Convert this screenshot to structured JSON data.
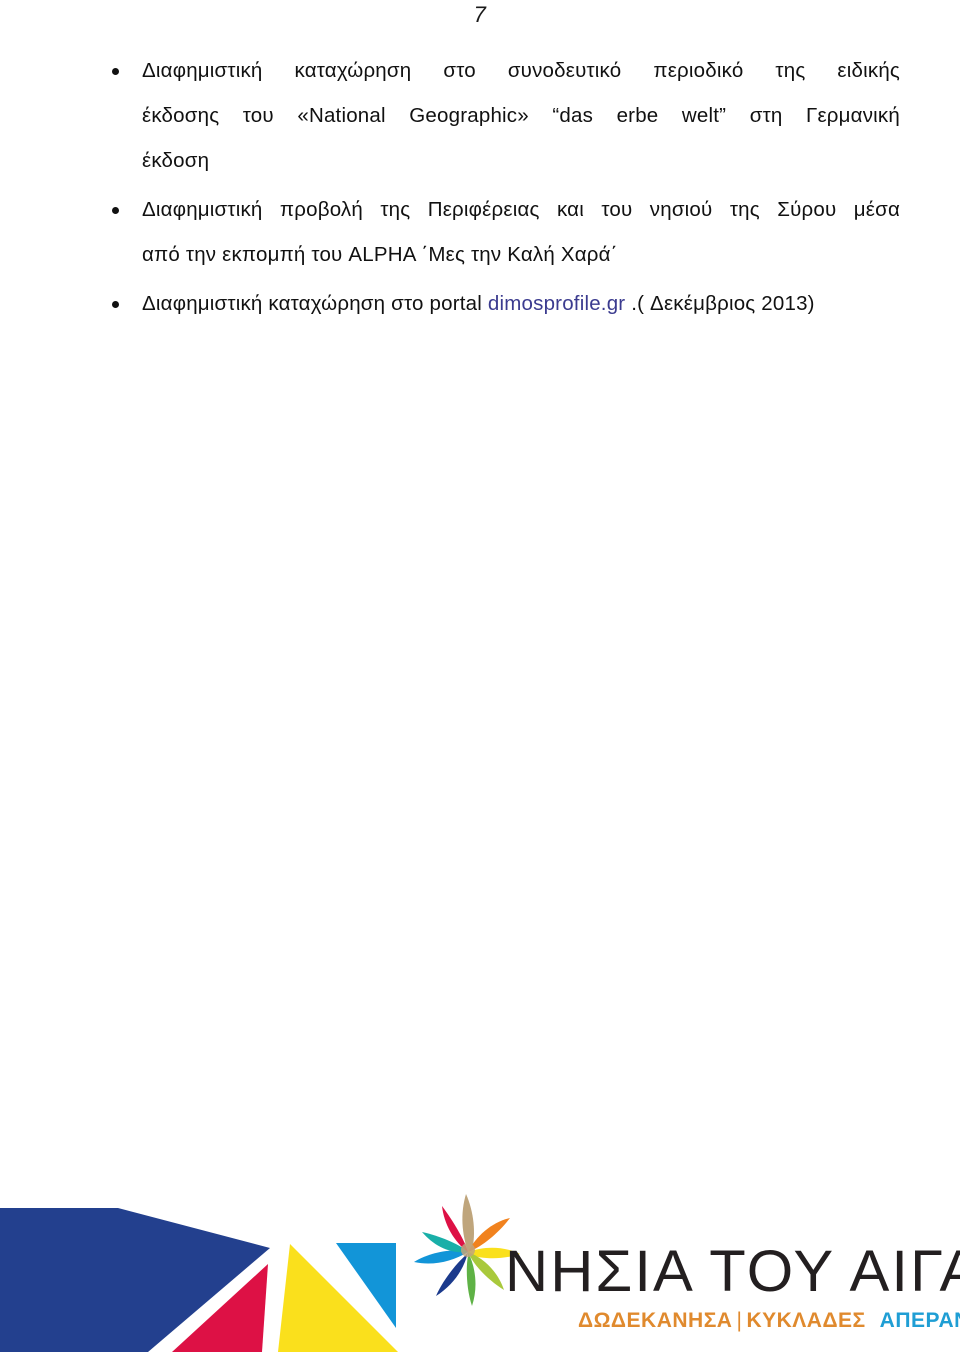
{
  "page": {
    "number": "7"
  },
  "content": {
    "bullets": [
      {
        "id": "bullet-national-geographic",
        "lines": [
          "Διαφημιστική καταχώρηση στο συνοδευτικό περιοδικό της ειδικής",
          "έκδοσης του «National Geographic» “das erbe welt” στη Γερμανική",
          "έκδοση"
        ]
      },
      {
        "id": "bullet-alpha-broadcast",
        "lines": [
          "Διαφημιστική προβολή της Περιφέρειας και του νησιού της Σύρου μέσα",
          "από την εκπομπή του ALPHA ΄Μες την Καλή Χαρά΄"
        ]
      },
      {
        "id": "bullet-dimosprofile-portal",
        "lines": [
          "Διαφημιστική καταχώρηση στο portal "
        ],
        "link_text": "dimosprofile.gr",
        "line_tail": " .( Δεκέμβριος 2013)"
      }
    ]
  },
  "footer": {
    "logo": {
      "wordmark": "ΝΗΣΙΑ ΤΟΥ ΑΙΓΑΙΟΥ",
      "subtitle_left": "ΔΩΔΕΚΑΝΗΣΑ",
      "subtitle_separator": "|",
      "subtitle_mid": "ΚΥΚΛΑΔΕΣ",
      "subtitle_right": "ΑΠΕΡΑΝΤΟ ΓΑΛΑΖΙΟ"
    },
    "colors": {
      "navy": "#23408E",
      "crimson": "#DD1145",
      "yellow": "#FAE01C",
      "cyan": "#1295D8",
      "orange": "#F1821E",
      "green": "#5FB246",
      "teal": "#19AFA8",
      "tan": "#BFA57C",
      "deep_blue": "#1B3A8C",
      "lime": "#A9C93C"
    }
  }
}
